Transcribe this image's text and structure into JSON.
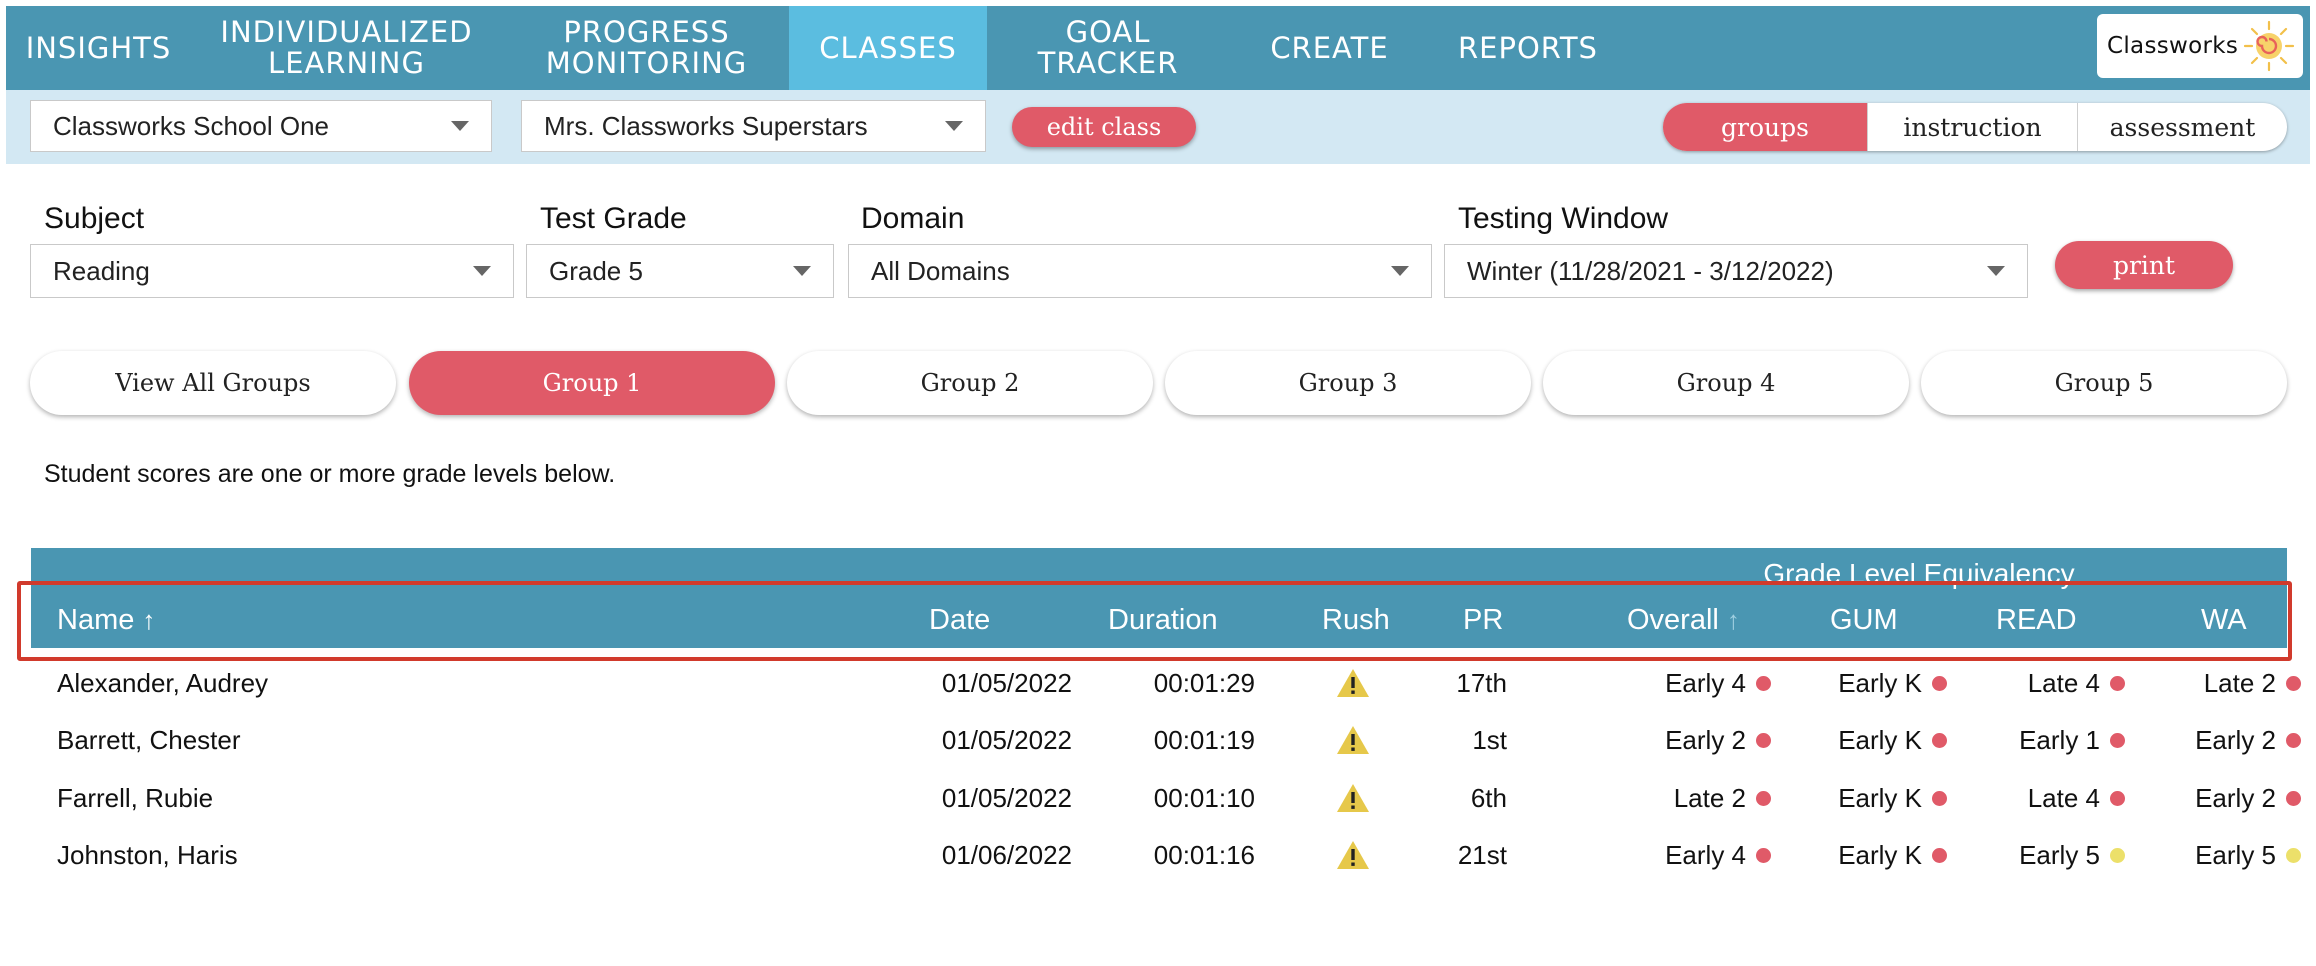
{
  "nav": {
    "items": [
      {
        "label": "INSIGHTS"
      },
      {
        "label": "INDIVIDUALIZED\nLEARNING"
      },
      {
        "label": "PROGRESS\nMONITORING"
      },
      {
        "label": "CLASSES",
        "active": true
      },
      {
        "label": "GOAL TRACKER"
      },
      {
        "label": "CREATE"
      },
      {
        "label": "REPORTS"
      }
    ],
    "logo_text": "Classworks",
    "logo_icon": "sun-swirl-icon",
    "colors": {
      "bar": "#4a96b2",
      "active": "#5bbde0"
    }
  },
  "subbar": {
    "school": "Classworks School One",
    "class": "Mrs. Classworks Superstars",
    "edit_class": "edit class",
    "views": {
      "groups": "groups",
      "instruction": "instruction",
      "assessment": "assessment"
    }
  },
  "filters": {
    "subject": {
      "label": "Subject",
      "value": "Reading"
    },
    "test_grade": {
      "label": "Test Grade",
      "value": "Grade 5"
    },
    "domain": {
      "label": "Domain",
      "value": "All Domains"
    },
    "testing_window": {
      "label": "Testing Window",
      "value": "Winter (11/28/2021 - 3/12/2022)"
    },
    "print": "print"
  },
  "groups": [
    "View All Groups",
    "Group 1",
    "Group 2",
    "Group 3",
    "Group 4",
    "Group 5"
  ],
  "active_group": "Group 1",
  "note": "Student scores are one or more grade levels below.",
  "table": {
    "super_header": "Grade Level Equivalency",
    "columns": {
      "name": "Name",
      "date": "Date",
      "duration": "Duration",
      "rush": "Rush",
      "pr": "PR",
      "overall": "Overall",
      "gum": "GUM",
      "read": "READ",
      "wa": "WA"
    },
    "sort_arrow": "↑",
    "rows": [
      {
        "name": "Alexander, Audrey",
        "date": "01/05/2022",
        "duration": "00:01:29",
        "rush": "warning-icon",
        "pr": "17th",
        "overall": "Early 4",
        "gum": "Early K",
        "read": "Late 4",
        "wa": "Late 2",
        "status": {
          "overall": "red",
          "gum": "red",
          "read": "red",
          "wa": "red"
        }
      },
      {
        "name": "Barrett, Chester",
        "date": "01/05/2022",
        "duration": "00:01:19",
        "rush": "warning-icon",
        "pr": "1st",
        "overall": "Early 2",
        "gum": "Early K",
        "read": "Early 1",
        "wa": "Early 2",
        "status": {
          "overall": "red",
          "gum": "red",
          "read": "red",
          "wa": "red"
        }
      },
      {
        "name": "Farrell, Rubie",
        "date": "01/05/2022",
        "duration": "00:01:10",
        "rush": "warning-icon",
        "pr": "6th",
        "overall": "Late 2",
        "gum": "Early K",
        "read": "Late 4",
        "wa": "Early 2",
        "status": {
          "overall": "red",
          "gum": "red",
          "read": "red",
          "wa": "red"
        }
      },
      {
        "name": "Johnston, Haris",
        "date": "01/06/2022",
        "duration": "00:01:16",
        "rush": "warning-icon",
        "pr": "21st",
        "overall": "Early 4",
        "gum": "Early K",
        "read": "Early 5",
        "wa": "Early 5",
        "status": {
          "overall": "red",
          "gum": "red",
          "read": "yellow",
          "wa": "yellow"
        }
      }
    ],
    "status_colors": {
      "red": "#e05a68",
      "yellow": "#ece06a",
      "warning": "#e6c84a"
    }
  }
}
